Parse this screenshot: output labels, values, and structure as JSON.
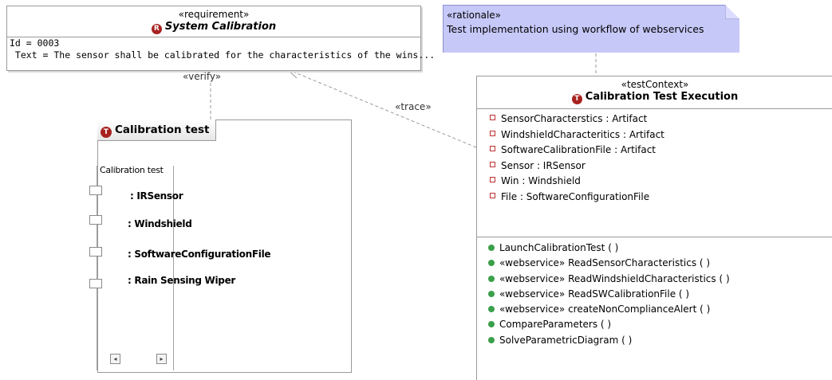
{
  "requirement": {
    "stereotype": "«requirement»",
    "badge": "R",
    "name": "System  Calibration",
    "id_line": "Id = 0003",
    "text_line": " Text = The sensor shall be calibrated for the characteristics of the wins..."
  },
  "rationale": {
    "stereotype": "«rationale»",
    "text": "Test implementation using workflow of webservices"
  },
  "connectors": {
    "verify_label": "«verify»",
    "trace_label": "«trace»"
  },
  "test_context": {
    "stereotype": "«testContext»",
    "badge": "T",
    "name": "Calibration Test Execution",
    "attributes": [
      "SensorCharacterstics : Artifact",
      "WindshieldCharacteritics : Artifact",
      "SoftwareCalibrationFile : Artifact",
      "Sensor : IRSensor",
      "Win : Windshield",
      "File : SoftwareConfigurationFile"
    ],
    "operations": [
      "LaunchCalibrationTest ( )",
      "«webservice» ReadSensorCharacteristics ( )",
      "«webservice» ReadWindshieldCharacteristics ( )",
      "«webservice» ReadSWCalibrationFile ( )",
      "«webservice» createNonComplianceAlert ( )",
      "CompareParameters ( )",
      "SolveParametricDiagram ( )"
    ]
  },
  "calibration_test": {
    "badge": "T",
    "title": "Calibration test",
    "inner_label": "Calibration test",
    "parts": [
      ": IRSensor",
      ": Windshield",
      ": SoftwareConfigurationFile",
      ": Rain Sensing Wiper"
    ],
    "scroll_left": "◂",
    "scroll_right": "▸"
  },
  "colors": {
    "note_fill": "#c6c8f8",
    "badge_red": "#a8221f",
    "operation_green": "#3aa04a",
    "attribute_red": "#c03030"
  }
}
